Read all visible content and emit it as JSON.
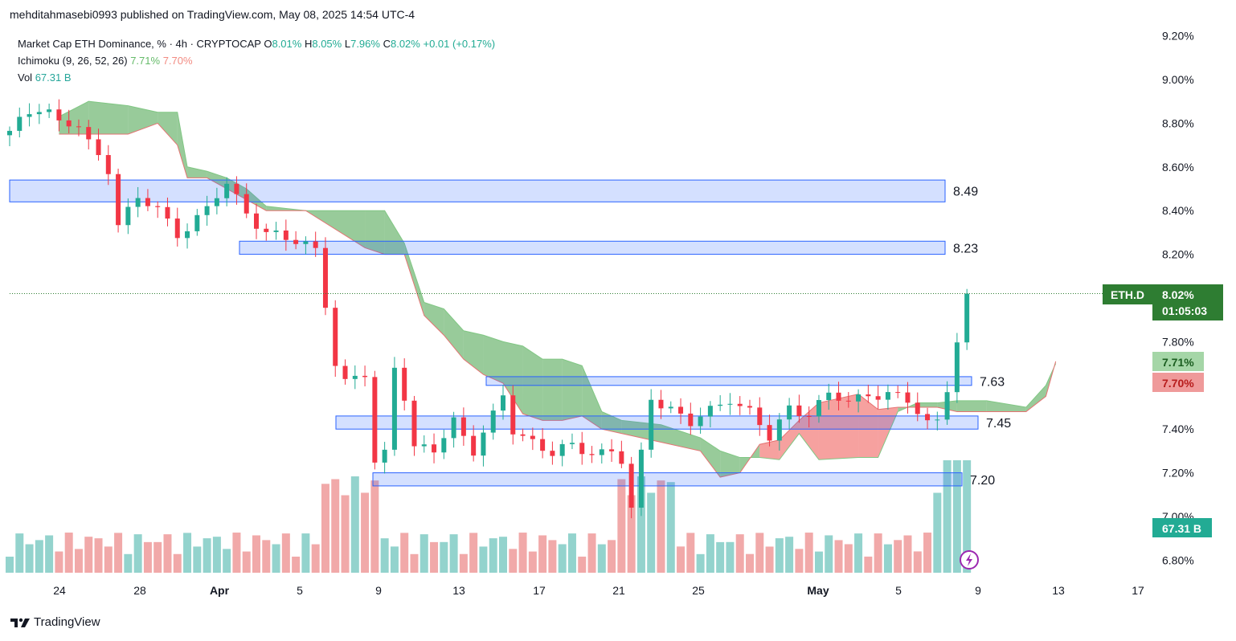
{
  "header": {
    "publisher_line": "mehditahmasebi0993 published on TradingView.com, May 08, 2025 14:54 UTC-4"
  },
  "legend": {
    "symbol_line": "Market Cap ETH Dominance, % · 4h · CRYPTOCAP",
    "ohlc": {
      "o_label": "O",
      "o": "8.01%",
      "h_label": "H",
      "h": "8.05%",
      "l_label": "L",
      "l": "7.96%",
      "c_label": "C",
      "c": "8.02%",
      "change": "+0.01 (+0.17%)"
    },
    "ichimoku_label": "Ichimoku (9, 26, 52, 26)",
    "ichimoku_a": "7.71%",
    "ichimoku_b": "7.70%",
    "vol_label": "Vol",
    "vol_value": "67.31 B"
  },
  "badges": {
    "symbol": "ETH.D",
    "price": "8.02%",
    "countdown": "01:05:03",
    "span_a": "7.71%",
    "span_b": "7.70%",
    "volume": "67.31 B"
  },
  "colors": {
    "up": "#22ab94",
    "down": "#f23645",
    "cloud_bull": "#43a047",
    "cloud_bear": "#ef5350",
    "zone_fill": "#2962ff",
    "badge_green": "#2e7d32",
    "badge_teal": "#22ab94",
    "span_a_badge": "#a5d6a7",
    "span_b_badge": "#ef9a9a"
  },
  "brand": "TradingView",
  "chart_data": {
    "type": "candlestick",
    "title": "Market Cap ETH Dominance, % · 4h · CRYPTOCAP",
    "y_unit": "%",
    "ylim": [
      6.76,
      9.28
    ],
    "y_ticks": [
      "9.20%",
      "9.00%",
      "8.80%",
      "8.60%",
      "8.40%",
      "8.20%",
      "7.80%",
      "7.40%",
      "7.20%",
      "7.00%",
      "6.80%"
    ],
    "x_ticks": [
      "24",
      "28",
      "Apr",
      "5",
      "9",
      "13",
      "17",
      "21",
      "25",
      "May",
      "5",
      "9",
      "13",
      "17"
    ],
    "last_price": 8.02,
    "zones": [
      {
        "label": "8.49",
        "low": 8.44,
        "high": 8.54
      },
      {
        "label": "8.23",
        "low": 8.2,
        "high": 8.26
      },
      {
        "label": "7.63",
        "low": 7.6,
        "high": 7.64
      },
      {
        "label": "7.45",
        "low": 7.4,
        "high": 7.46
      },
      {
        "label": "7.20",
        "low": 7.14,
        "high": 7.2
      }
    ],
    "price_path": [
      [
        0,
        8.75
      ],
      [
        2,
        8.85
      ],
      [
        3.5,
        8.9
      ],
      [
        5,
        8.8
      ],
      [
        7,
        8.78
      ],
      [
        8,
        8.7
      ],
      [
        10,
        8.6
      ],
      [
        11,
        8.35
      ],
      [
        13,
        8.45
      ],
      [
        15,
        8.4
      ],
      [
        17,
        8.3
      ],
      [
        20,
        8.4
      ],
      [
        22,
        8.52
      ],
      [
        24,
        8.4
      ],
      [
        26,
        8.3
      ],
      [
        28,
        8.26
      ],
      [
        30,
        8.25
      ],
      [
        31.5,
        8.22
      ],
      [
        32.5,
        7.75
      ],
      [
        34,
        7.6
      ],
      [
        36,
        7.65
      ],
      [
        37,
        7.25
      ],
      [
        38,
        7.3
      ],
      [
        39,
        7.7
      ],
      [
        40,
        7.55
      ],
      [
        41,
        7.3
      ],
      [
        43,
        7.3
      ],
      [
        45,
        7.45
      ],
      [
        47,
        7.3
      ],
      [
        49,
        7.45
      ],
      [
        50,
        7.55
      ],
      [
        51,
        7.4
      ],
      [
        53,
        7.35
      ],
      [
        55,
        7.28
      ],
      [
        57,
        7.32
      ],
      [
        59,
        7.3
      ],
      [
        61,
        7.3
      ],
      [
        62,
        7.25
      ],
      [
        63,
        7.02
      ],
      [
        64,
        7.28
      ],
      [
        65,
        7.55
      ],
      [
        67,
        7.5
      ],
      [
        69,
        7.42
      ],
      [
        71,
        7.48
      ],
      [
        73,
        7.55
      ],
      [
        75,
        7.48
      ],
      [
        77,
        7.35
      ],
      [
        79,
        7.5
      ],
      [
        81,
        7.48
      ],
      [
        83,
        7.55
      ],
      [
        85,
        7.52
      ],
      [
        87,
        7.57
      ],
      [
        89,
        7.56
      ],
      [
        91,
        7.52
      ],
      [
        93,
        7.43
      ],
      [
        94,
        7.45
      ],
      [
        95,
        7.6
      ],
      [
        96,
        7.8
      ],
      [
        97,
        8.02
      ]
    ],
    "cloud": [
      [
        5,
        8.83,
        8.75
      ],
      [
        8,
        8.9,
        8.75
      ],
      [
        12,
        8.88,
        8.75
      ],
      [
        15,
        8.85,
        8.8
      ],
      [
        17,
        8.85,
        8.7
      ],
      [
        18,
        8.6,
        8.55
      ],
      [
        20,
        8.58,
        8.55
      ],
      [
        22,
        8.55,
        8.5
      ],
      [
        24,
        8.5,
        8.45
      ],
      [
        26,
        8.42,
        8.4
      ],
      [
        30,
        8.4,
        8.4
      ],
      [
        36,
        8.4,
        8.23
      ],
      [
        38,
        8.4,
        8.2
      ],
      [
        40,
        8.25,
        8.2
      ],
      [
        42,
        7.98,
        7.92
      ],
      [
        44,
        7.95,
        7.83
      ],
      [
        46,
        7.85,
        7.72
      ],
      [
        48,
        7.83,
        7.65
      ],
      [
        50,
        7.8,
        7.61
      ],
      [
        52,
        7.78,
        7.47
      ],
      [
        54,
        7.72,
        7.44
      ],
      [
        56,
        7.72,
        7.44
      ],
      [
        58,
        7.69,
        7.46
      ],
      [
        60,
        7.48,
        7.4
      ],
      [
        62,
        7.44,
        7.38
      ],
      [
        66,
        7.42,
        7.34
      ],
      [
        70,
        7.36,
        7.3
      ],
      [
        72,
        7.3,
        7.18
      ],
      [
        74,
        7.27,
        7.2
      ],
      [
        76,
        7.27,
        7.33
      ],
      [
        78,
        7.26,
        7.35
      ],
      [
        80,
        7.38,
        7.44
      ],
      [
        82,
        7.26,
        7.52
      ],
      [
        86,
        7.27,
        7.56
      ],
      [
        88,
        7.27,
        7.49
      ],
      [
        90,
        7.48,
        7.5
      ],
      [
        92,
        7.52,
        7.5
      ],
      [
        94,
        7.52,
        7.5
      ],
      [
        96,
        7.53,
        7.48
      ],
      [
        99,
        7.53,
        7.48
      ],
      [
        103,
        7.5,
        7.48
      ],
      [
        105,
        7.6,
        7.55
      ],
      [
        106,
        7.7,
        7.71
      ]
    ],
    "volume_unit": "B",
    "last_volume": 67.31
  }
}
